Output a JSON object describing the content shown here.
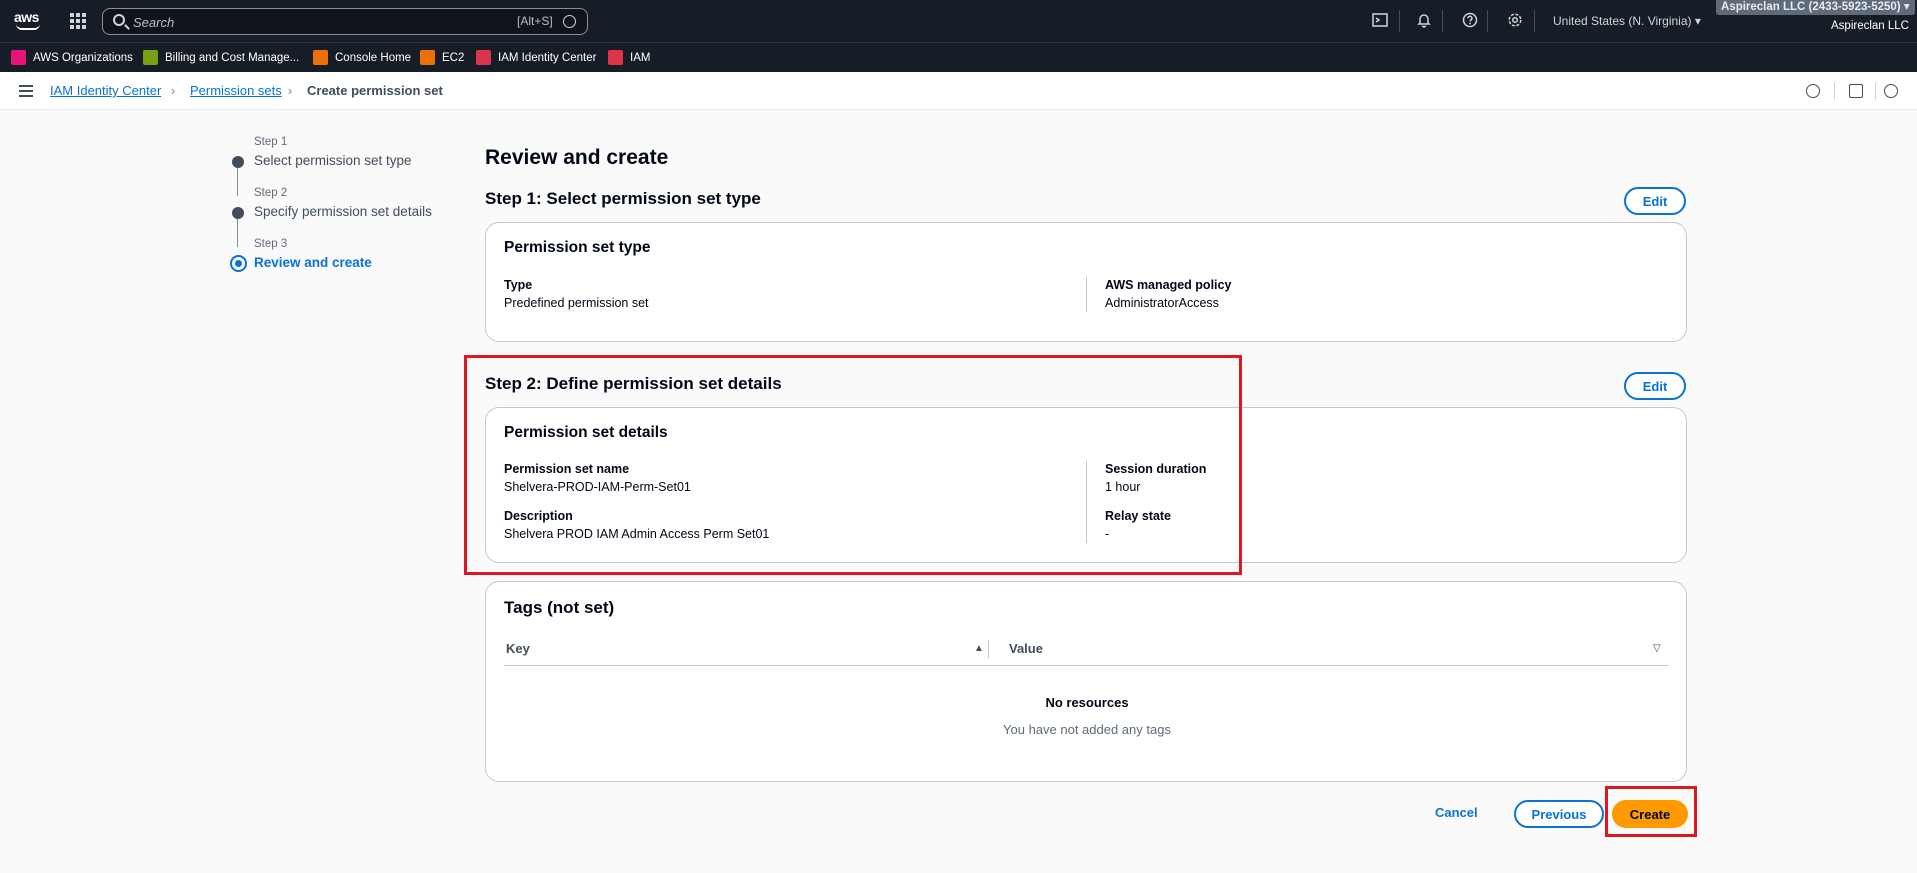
{
  "topnav": {
    "search_placeholder": "Search",
    "search_shortcut": "[Alt+S]",
    "region": "United States (N. Virginia)",
    "account_badge": "Aspireclan LLC (2433-5923-5250)",
    "account_name": "Aspireclan LLC"
  },
  "favorites": [
    {
      "label": "AWS Organizations",
      "color": "#e7157b"
    },
    {
      "label": "Billing and Cost Manage...",
      "color": "#7aa116"
    },
    {
      "label": "Console Home",
      "color": "#ed7100"
    },
    {
      "label": "EC2",
      "color": "#ed7100"
    },
    {
      "label": "IAM Identity Center",
      "color": "#dd344c"
    },
    {
      "label": "IAM",
      "color": "#dd344c"
    }
  ],
  "breadcrumb": {
    "items": [
      "IAM Identity Center",
      "Permission sets"
    ],
    "current": "Create permission set"
  },
  "wizard": {
    "steps": [
      {
        "number": "Step 1",
        "title": "Select permission set type"
      },
      {
        "number": "Step 2",
        "title": "Specify permission set details"
      },
      {
        "number": "Step 3",
        "title": "Review and create"
      }
    ]
  },
  "main": {
    "title": "Review and create",
    "edit_label": "Edit",
    "step1": {
      "heading": "Step 1: Select permission set type",
      "card_title": "Permission set type",
      "type_label": "Type",
      "type_value": "Predefined permission set",
      "policy_label": "AWS managed policy",
      "policy_value": "AdministratorAccess"
    },
    "step2": {
      "heading": "Step 2: Define permission set details",
      "card_title": "Permission set details",
      "name_label": "Permission set name",
      "name_value": "Shelvera-PROD-IAM-Perm-Set01",
      "desc_label": "Description",
      "desc_value": "Shelvera PROD IAM Admin Access Perm Set01",
      "session_label": "Session duration",
      "session_value": "1 hour",
      "relay_label": "Relay state",
      "relay_value": "-"
    },
    "tags": {
      "title": "Tags (not set)",
      "col_key": "Key",
      "col_value": "Value",
      "empty_title": "No resources",
      "empty_sub": "You have not added any tags"
    }
  },
  "footer": {
    "cancel": "Cancel",
    "previous": "Previous",
    "create": "Create"
  },
  "colors": {
    "accent": "#0972d3",
    "primary_button": "#ff9900",
    "highlight": "#e0171f",
    "nav_bg": "#161d26"
  }
}
